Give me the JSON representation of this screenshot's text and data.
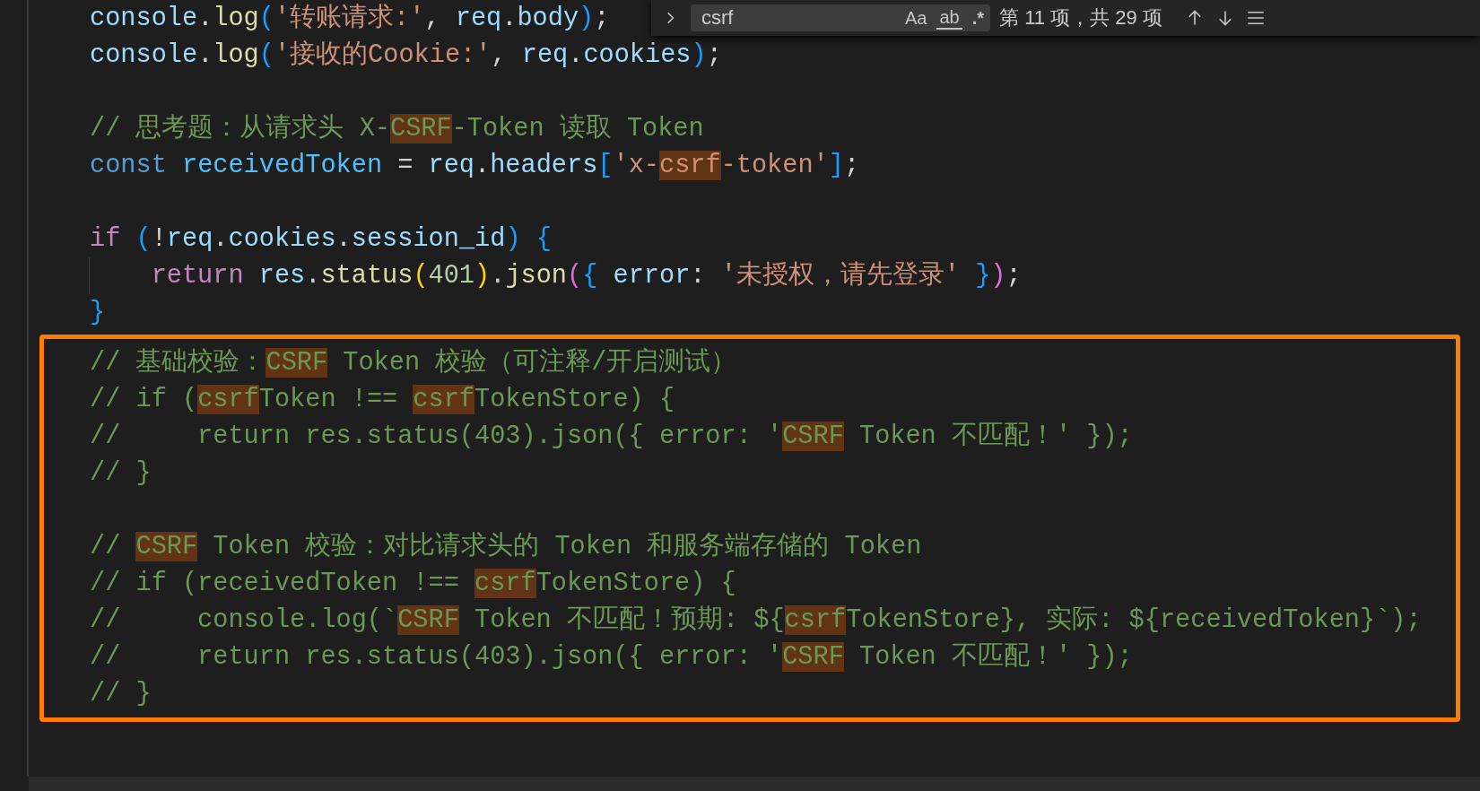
{
  "find_widget": {
    "query": "csrf",
    "options": [
      {
        "label": "Aa",
        "kind": "case"
      },
      {
        "label": "ab",
        "kind": "word"
      },
      {
        "label": ".*",
        "kind": "regex"
      }
    ],
    "result": "第 11 项，共 29 项"
  },
  "editor": {
    "lines": [
      {
        "kind": "code",
        "indent_guide": false,
        "segments": [
          {
            "text": "console",
            "kind": "variable",
            "match": false
          },
          {
            "text": ".",
            "kind": "punct",
            "match": false
          },
          {
            "text": "log",
            "kind": "function",
            "match": false
          },
          {
            "text": "(",
            "kind": "bracket3",
            "match": false
          },
          {
            "text": "'转账请求:'",
            "kind": "string",
            "match": false
          },
          {
            "text": ", ",
            "kind": "punct",
            "match": false
          },
          {
            "text": "req",
            "kind": "variable",
            "match": false
          },
          {
            "text": ".",
            "kind": "punct",
            "match": false
          },
          {
            "text": "body",
            "kind": "variable",
            "match": false
          },
          {
            "text": ")",
            "kind": "bracket3",
            "match": false
          },
          {
            "text": ";",
            "kind": "punct",
            "match": false
          }
        ]
      },
      {
        "kind": "code",
        "indent_guide": false,
        "segments": [
          {
            "text": "console",
            "kind": "variable",
            "match": false
          },
          {
            "text": ".",
            "kind": "punct",
            "match": false
          },
          {
            "text": "log",
            "kind": "function",
            "match": false
          },
          {
            "text": "(",
            "kind": "bracket3",
            "match": false
          },
          {
            "text": "'接收的Cookie:'",
            "kind": "string",
            "match": false
          },
          {
            "text": ", ",
            "kind": "punct",
            "match": false
          },
          {
            "text": "req",
            "kind": "variable",
            "match": false
          },
          {
            "text": ".",
            "kind": "punct",
            "match": false
          },
          {
            "text": "cookies",
            "kind": "variable",
            "match": false
          },
          {
            "text": ")",
            "kind": "bracket3",
            "match": false
          },
          {
            "text": ";",
            "kind": "punct",
            "match": false
          }
        ]
      },
      {
        "kind": "blank"
      },
      {
        "kind": "code",
        "indent_guide": false,
        "segments": [
          {
            "text": "// 思考题：从请求头 X-",
            "kind": "comment",
            "match": false
          },
          {
            "text": "CSRF",
            "kind": "comment",
            "match": true
          },
          {
            "text": "-Token 读取 Token",
            "kind": "comment",
            "match": false
          }
        ]
      },
      {
        "kind": "code",
        "indent_guide": false,
        "segments": [
          {
            "text": "const ",
            "kind": "storage",
            "match": false
          },
          {
            "text": "receivedToken",
            "kind": "constant",
            "match": false
          },
          {
            "text": " = ",
            "kind": "punct",
            "match": false
          },
          {
            "text": "req",
            "kind": "variable",
            "match": false
          },
          {
            "text": ".",
            "kind": "punct",
            "match": false
          },
          {
            "text": "headers",
            "kind": "variable",
            "match": false
          },
          {
            "text": "[",
            "kind": "bracket3",
            "match": false
          },
          {
            "text": "'x-",
            "kind": "string",
            "match": false
          },
          {
            "text": "csrf",
            "kind": "string",
            "match": true
          },
          {
            "text": "-token'",
            "kind": "string",
            "match": false
          },
          {
            "text": "]",
            "kind": "bracket3",
            "match": false
          },
          {
            "text": ";",
            "kind": "punct",
            "match": false
          }
        ]
      },
      {
        "kind": "blank"
      },
      {
        "kind": "code",
        "indent_guide": false,
        "segments": [
          {
            "text": "if ",
            "kind": "keyword",
            "match": false
          },
          {
            "text": "(",
            "kind": "bracket3",
            "match": false
          },
          {
            "text": "!",
            "kind": "punct",
            "match": false
          },
          {
            "text": "req",
            "kind": "variable",
            "match": false
          },
          {
            "text": ".",
            "kind": "punct",
            "match": false
          },
          {
            "text": "cookies",
            "kind": "variable",
            "match": false
          },
          {
            "text": ".",
            "kind": "punct",
            "match": false
          },
          {
            "text": "session_id",
            "kind": "variable",
            "match": false
          },
          {
            "text": ") {",
            "kind": "bracket3",
            "match": false
          }
        ]
      },
      {
        "kind": "code",
        "indent_guide": true,
        "segments": [
          {
            "text": "    return ",
            "kind": "keyword",
            "match": false
          },
          {
            "text": "res",
            "kind": "variable",
            "match": false
          },
          {
            "text": ".",
            "kind": "punct",
            "match": false
          },
          {
            "text": "status",
            "kind": "function",
            "match": false
          },
          {
            "text": "(",
            "kind": "bracket1",
            "match": false
          },
          {
            "text": "401",
            "kind": "number",
            "match": false
          },
          {
            "text": ")",
            "kind": "bracket1",
            "match": false
          },
          {
            "text": ".",
            "kind": "punct",
            "match": false
          },
          {
            "text": "json",
            "kind": "function",
            "match": false
          },
          {
            "text": "(",
            "kind": "bracket2",
            "match": false
          },
          {
            "text": "{",
            "kind": "bracket3",
            "match": false
          },
          {
            "text": " error",
            "kind": "variable",
            "match": false
          },
          {
            "text": ": ",
            "kind": "punct",
            "match": false
          },
          {
            "text": "'未授权，请先登录' ",
            "kind": "string",
            "match": false
          },
          {
            "text": "}",
            "kind": "bracket3",
            "match": false
          },
          {
            "text": ")",
            "kind": "bracket2",
            "match": false
          },
          {
            "text": ";",
            "kind": "punct",
            "match": false
          }
        ]
      },
      {
        "kind": "code",
        "indent_guide": false,
        "segments": [
          {
            "text": "}",
            "kind": "bracket3",
            "match": false
          }
        ]
      }
    ],
    "boxed_lines": [
      {
        "kind": "code",
        "indent_guide": false,
        "segments": [
          {
            "text": "// 基础校验：",
            "kind": "comment",
            "match": false
          },
          {
            "text": "CSRF",
            "kind": "comment",
            "match": true
          },
          {
            "text": " Token 校验（可注释/开启测试）",
            "kind": "comment",
            "match": false
          }
        ]
      },
      {
        "kind": "code",
        "indent_guide": false,
        "segments": [
          {
            "text": "// if (",
            "kind": "comment",
            "match": false
          },
          {
            "text": "csrf",
            "kind": "comment",
            "match": true
          },
          {
            "text": "Token !== ",
            "kind": "comment",
            "match": false
          },
          {
            "text": "csrf",
            "kind": "comment",
            "match": true
          },
          {
            "text": "TokenStore) {",
            "kind": "comment",
            "match": false
          }
        ]
      },
      {
        "kind": "code",
        "indent_guide": false,
        "segments": [
          {
            "text": "//     return res.status(403).json({ error: '",
            "kind": "comment",
            "match": false
          },
          {
            "text": "CSRF",
            "kind": "comment",
            "match": true
          },
          {
            "text": " Token 不匹配！' });",
            "kind": "comment",
            "match": false
          }
        ]
      },
      {
        "kind": "code",
        "indent_guide": false,
        "segments": [
          {
            "text": "// }",
            "kind": "comment",
            "match": false
          }
        ]
      },
      {
        "kind": "blank"
      },
      {
        "kind": "code",
        "indent_guide": false,
        "segments": [
          {
            "text": "// ",
            "kind": "comment",
            "match": false
          },
          {
            "text": "CSRF",
            "kind": "comment",
            "match": true
          },
          {
            "text": " Token 校验：对比请求头的 Token 和服务端存储的 Token",
            "kind": "comment",
            "match": false
          }
        ]
      },
      {
        "kind": "code",
        "indent_guide": false,
        "segments": [
          {
            "text": "// if (receivedToken !== ",
            "kind": "comment",
            "match": false
          },
          {
            "text": "csrf",
            "kind": "comment",
            "match": true
          },
          {
            "text": "TokenStore) {",
            "kind": "comment",
            "match": false
          }
        ]
      },
      {
        "kind": "code",
        "indent_guide": false,
        "segments": [
          {
            "text": "//     console.log(`",
            "kind": "comment",
            "match": false
          },
          {
            "text": "CSRF",
            "kind": "comment",
            "match": true
          },
          {
            "text": " Token 不匹配！预期: ${",
            "kind": "comment",
            "match": false
          },
          {
            "text": "csrf",
            "kind": "comment",
            "match": true
          },
          {
            "text": "TokenStore}, 实际: ${receivedToken}`);",
            "kind": "comment",
            "match": false
          }
        ]
      },
      {
        "kind": "code",
        "indent_guide": false,
        "segments": [
          {
            "text": "//     return res.status(403).json({ error: '",
            "kind": "comment",
            "match": false
          },
          {
            "text": "CSRF",
            "kind": "comment",
            "match": true
          },
          {
            "text": " Token 不匹配！' });",
            "kind": "comment",
            "match": false
          }
        ]
      },
      {
        "kind": "code",
        "indent_guide": false,
        "segments": [
          {
            "text": "// }",
            "kind": "comment",
            "match": false
          }
        ]
      }
    ]
  }
}
